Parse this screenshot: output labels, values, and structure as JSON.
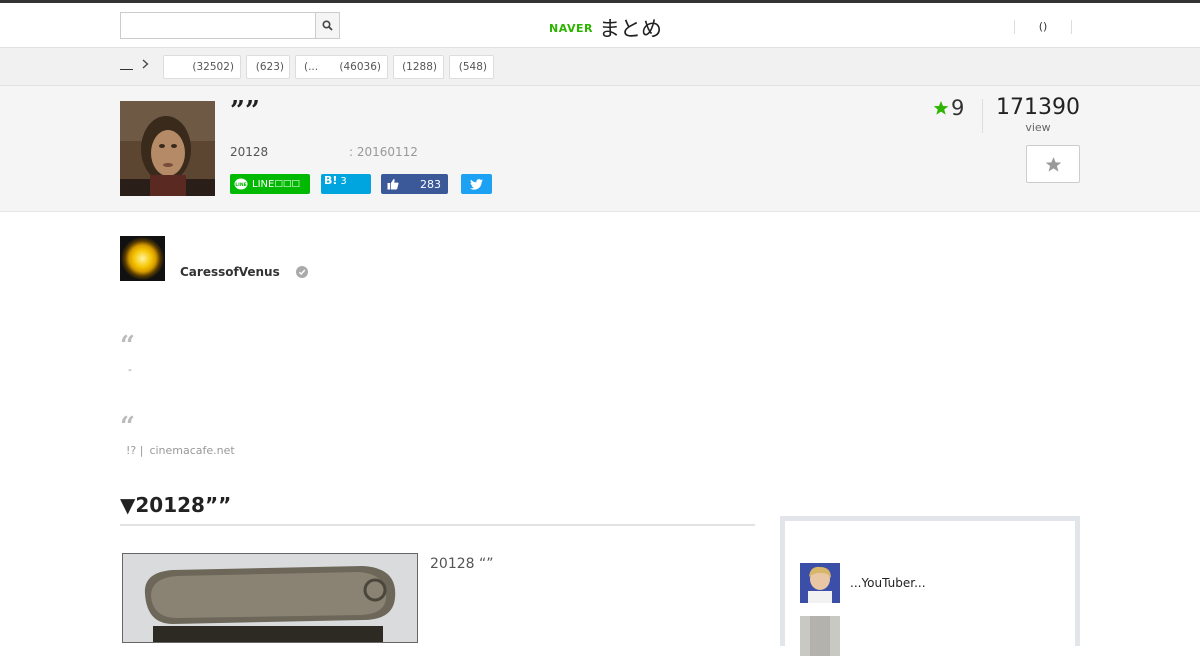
{
  "header": {
    "search_placeholder": "",
    "search_value": "",
    "logo_naver": "NAVER",
    "logo_matome": "まとめ",
    "right_text": "()"
  },
  "breadcrumb": {
    "label": ""
  },
  "categories": [
    {
      "label": "",
      "count": "(32502)"
    },
    {
      "label": "",
      "count": "(623)"
    },
    {
      "label": "(...",
      "count": "(46036)"
    },
    {
      "label": "",
      "count": "(1288)"
    },
    {
      "label": "",
      "count": "(548)"
    }
  ],
  "article": {
    "title": "””",
    "meta_left": "20128",
    "meta_date": ": 20160112",
    "favorites": "9",
    "views": "171390",
    "views_label": "view"
  },
  "share": {
    "line_label": "LINE",
    "line_suffix": "□□□",
    "hatena_label": "B!",
    "hatena_count": "3",
    "facebook_count": "283"
  },
  "author": {
    "name": "CaressofVenus"
  },
  "quotes": [
    {
      "text": "-"
    },
    {
      "text": "!? |",
      "source": "cinemacafe.net"
    }
  ],
  "section": {
    "heading": "▼20128””",
    "image_caption": "20128 “”"
  },
  "sidebar": {
    "items": [
      {
        "title": "...YouTuber..."
      },
      {
        "title": ""
      }
    ]
  },
  "colors": {
    "naver_green": "#2db400",
    "line_green": "#00b900",
    "hatena_blue": "#00a4de",
    "facebook_blue": "#3b5998",
    "twitter_blue": "#1da1f2"
  }
}
